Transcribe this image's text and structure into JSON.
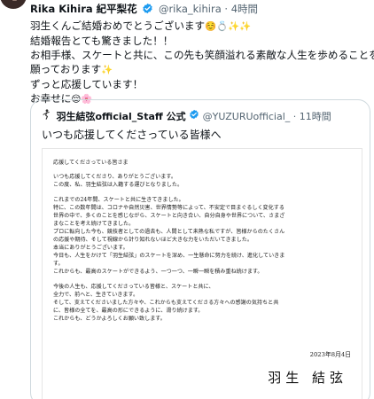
{
  "post": {
    "display_name": "Rika Kihira 紀平梨花",
    "handle": "@rika_kihira",
    "separator": "·",
    "time": "4時間",
    "lines": [
      "羽生くんご結婚おめでとうございます",
      "結婚報告とても驚きました！！",
      "お相手様、スケートと共に、この先も笑顔溢れる素敵な人生を歩めることを",
      "願っております",
      "ずっと応援しています！",
      "お幸せに"
    ],
    "emojis": {
      "line1": "☺️💍✨✨",
      "line4": "✨",
      "line6": "😌🌸"
    }
  },
  "quote": {
    "name": "羽生結弦official_Staff 公式",
    "handle": "@YUZURUofficial_",
    "separator": "·",
    "time": "11時間",
    "text": "いつも応援してくださっている皆様へ",
    "letter": {
      "lines": [
        "応援してくださっている皆さま",
        "いつも応援してくださり、ありがとうございます。",
        "この度、私、羽生結弦は入籍する運びとなりました。",
        "これまでの24年間、スケートと共に生きてきました。",
        "特に、この数年間は、コロナや自然災害、世界情勢等によって、不安定で目まぐるしく変化する",
        "世界の中で、多くのことを感じながら、スケートと向き合い、自分自身や世界について、さまざ",
        "まなことを考え続けてきました。",
        "プロに転向した今も、競技者としての過去も、人間として未熟な私ですが、皆様からのたくさん",
        "の応援や期待、そして視線から計り知れないほど大きな力をいただいてきました。",
        "本当にありがとうございます。",
        "今日も、人生をかけて「羽生結弦」のスケートを深め、一生懸命に努力を続け、進化していきま",
        "す。",
        "これからも、最高のスケートができるよう、一つ一つ、一瞬一瞬を積み重ね続けます。",
        "今後の人生も、応援してくださっている皆様と、スケートと共に、",
        "全力で、前へと、生きていきます。",
        "そして、支えてくださいました方々や、これからも支えてくださる方々への感謝の気持ちと共",
        "に、皆様の全てを、最高の形にできるように、滑り続けます。",
        "これからも、どうかよろしくお願い致します。"
      ],
      "date": "2023年8月4日",
      "signature": "羽生 結弦"
    }
  },
  "colors": {
    "verified": "#1d9bf0",
    "secondary_text": "#536471",
    "border": "#cfd9de"
  },
  "icons": {
    "verified": "verified-badge-icon",
    "quote_avatar": "figure-skater-icon"
  }
}
